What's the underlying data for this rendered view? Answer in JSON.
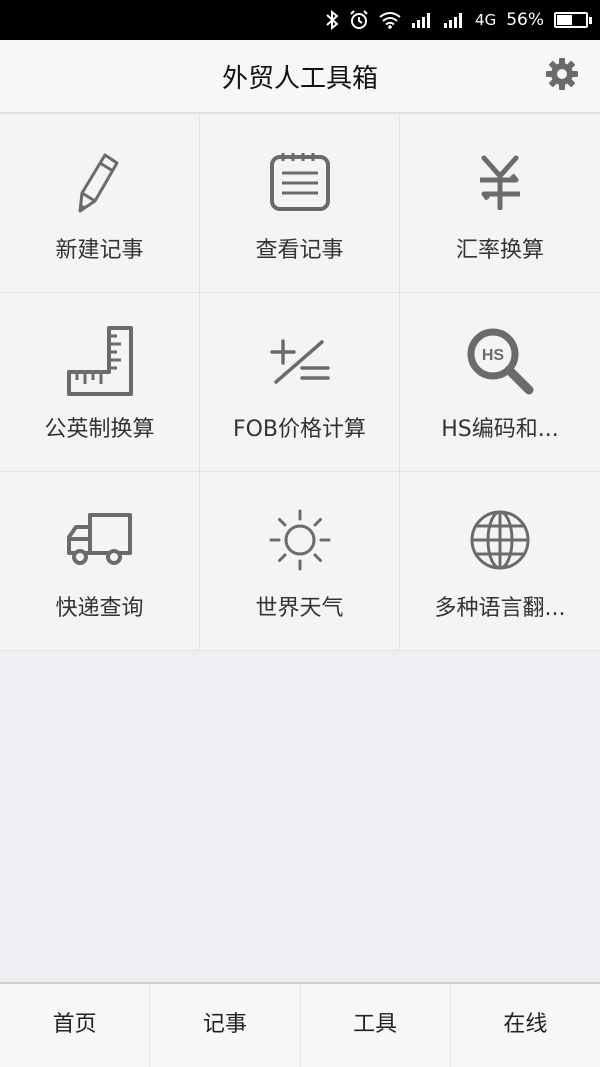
{
  "status_bar": {
    "network": "4G",
    "battery_percent": "56%",
    "battery_level": 0.56,
    "icons": [
      "bluetooth-icon",
      "alarm-icon",
      "wifi-icon",
      "signal-icon",
      "signal-icon"
    ]
  },
  "header": {
    "title": "外贸人工具箱",
    "settings_icon": "gear-icon"
  },
  "tools": [
    {
      "label": "新建记事",
      "icon": "pencil-icon"
    },
    {
      "label": "查看记事",
      "icon": "notepad-icon"
    },
    {
      "label": "汇率换算",
      "icon": "yen-exchange-icon"
    },
    {
      "label": "公英制换算",
      "icon": "ruler-icon"
    },
    {
      "label": "FOB价格计算",
      "icon": "calculator-icon"
    },
    {
      "label": "HS编码和...",
      "icon": "hs-search-icon"
    },
    {
      "label": "快递查询",
      "icon": "truck-icon"
    },
    {
      "label": "世界天气",
      "icon": "sun-icon"
    },
    {
      "label": "多种语言翻...",
      "icon": "globe-icon"
    }
  ],
  "tab_bar": {
    "tabs": [
      {
        "label": "首页"
      },
      {
        "label": "记事"
      },
      {
        "label": "工具"
      },
      {
        "label": "在线"
      }
    ]
  },
  "colors": {
    "icon_gray": "#6b6b6b",
    "background": "#efeff3",
    "status_bar": "#000000"
  }
}
